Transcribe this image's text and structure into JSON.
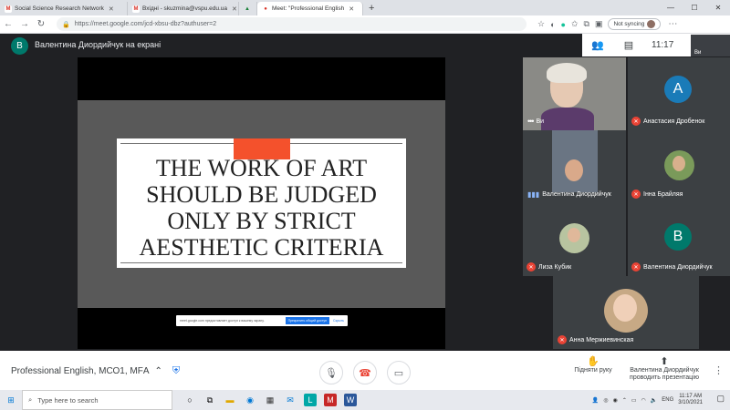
{
  "browser": {
    "tabs": [
      {
        "label": "Social Science Research Network",
        "fav": "S",
        "color": "#d93025"
      },
      {
        "label": "Вхідні - skuzmina@vspu.edu.ua",
        "fav": "M",
        "color": "#d93025"
      },
      {
        "label": "",
        "fav": "▲",
        "color": "#188038"
      },
      {
        "label": "Meet: \"Professional English",
        "fav": "●",
        "color": "#d93025"
      }
    ],
    "url": "https://meet.google.com/jcd-xbsu-dbz?authuser=2",
    "sync_label": "Not syncing"
  },
  "meet": {
    "presenter_initial": "В",
    "presenter_text": "Валентина Диордийчук на екрані",
    "time": "11:17",
    "self_thumb_label": "Ви",
    "slide_title": [
      "THE WORK OF ART",
      "SHOULD BE JUDGED",
      "ONLY BY STRICT",
      "AESTHETIC CRITERIA"
    ],
    "share_bar": {
      "message": "meet.google.com предоставляет доступ к вашему экрану.",
      "stop_label": "Прекратить общий доступ",
      "hide_label": "Скрыть"
    },
    "participants": [
      {
        "name": "Ви"
      },
      {
        "name": "Анастасия Дробенок",
        "initial": "A",
        "color": "#1a7bb8"
      },
      {
        "name": "Валентина Диордийчук"
      },
      {
        "name": "Інна Брайляя"
      },
      {
        "name": "Лиза Кубик"
      },
      {
        "name": "Валентина Диордийчук",
        "initial": "В",
        "color": "#00796b"
      },
      {
        "name": "Анна Мержиевинская"
      }
    ],
    "meeting_name": "Professional English, МСО1, МFА",
    "raise_hand_label": "Підняти руку",
    "presenting_label": [
      "Валентина Диордийчук",
      "проводить презентацію"
    ]
  },
  "taskbar": {
    "search_placeholder": "Type here to search",
    "tray_lang": "ENG",
    "time": "11:17 AM",
    "date": "3/10/2021"
  }
}
